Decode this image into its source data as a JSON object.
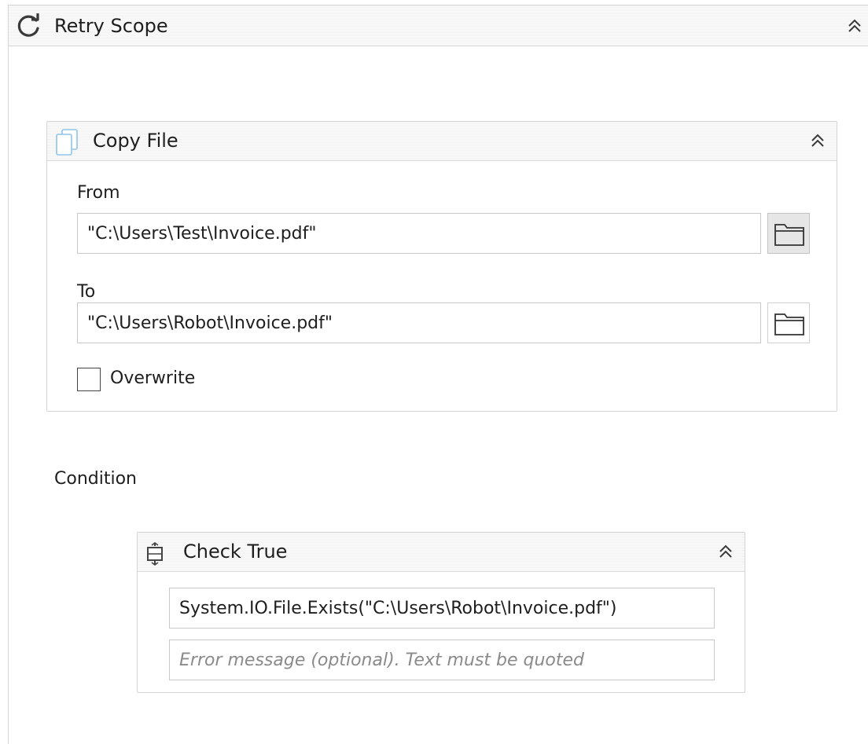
{
  "retry_scope": {
    "title": "Retry Scope",
    "icon": "refresh-icon",
    "condition_label": "Condition"
  },
  "copy_file": {
    "title": "Copy File",
    "icon": "copy-file-icon",
    "from_label": "From",
    "from_value": "\"C:\\Users\\Test\\Invoice.pdf\"",
    "to_label": "To",
    "to_value": "\"C:\\Users\\Robot\\Invoice.pdf\"",
    "overwrite_label": "Overwrite",
    "overwrite_checked": false
  },
  "check_true": {
    "title": "Check True",
    "icon": "check-true-icon",
    "expression_value": "System.IO.File.Exists(\"C:\\Users\\Robot\\Invoice.pdf\")",
    "error_placeholder": "Error message (optional). Text must be quoted"
  },
  "colors": {
    "border": "#d4d4d4",
    "header_bg": "#f6f6f6",
    "text": "#1e1e1e",
    "placeholder": "#8a8a8a",
    "icon_blue": "#7fb6e0"
  }
}
